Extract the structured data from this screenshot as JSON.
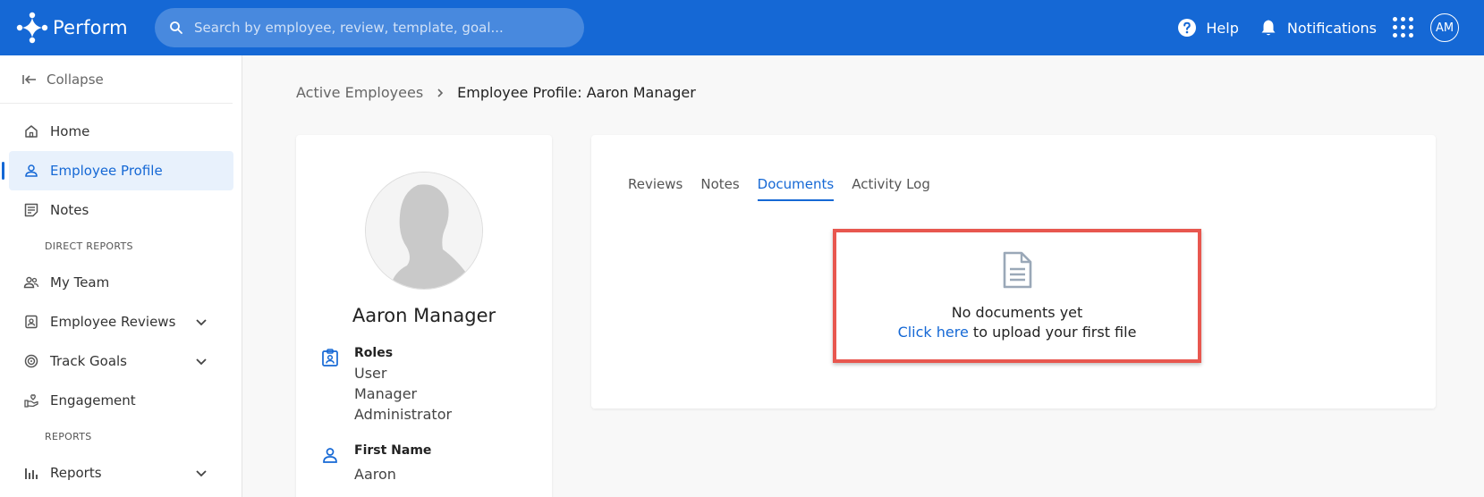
{
  "app": {
    "name": "Perform"
  },
  "search": {
    "placeholder": "Search by employee, review, template, goal..."
  },
  "topbar": {
    "help": "Help",
    "notifications": "Notifications",
    "avatar_initials": "AM"
  },
  "sidebar": {
    "collapse": "Collapse",
    "items": {
      "home": "Home",
      "employee_profile": "Employee Profile",
      "notes": "Notes",
      "my_team": "My Team",
      "employee_reviews": "Employee Reviews",
      "track_goals": "Track Goals",
      "engagement": "Engagement",
      "reports": "Reports"
    },
    "sections": {
      "direct_reports": "DIRECT REPORTS",
      "reports": "REPORTS"
    }
  },
  "breadcrumb": {
    "parent": "Active Employees",
    "current": "Employee Profile: Aaron Manager"
  },
  "profile": {
    "name": "Aaron Manager",
    "roles_label": "Roles",
    "roles": [
      "User",
      "Manager",
      "Administrator"
    ],
    "first_name_label": "First Name",
    "first_name": "Aaron"
  },
  "tabs": [
    "Reviews",
    "Notes",
    "Documents",
    "Activity Log"
  ],
  "active_tab": "Documents",
  "documents": {
    "empty_title": "No documents yet",
    "link_text": "Click here",
    "upload_text": " to upload your first file"
  },
  "colors": {
    "brand": "#1568d5",
    "highlight": "#e8574f"
  }
}
